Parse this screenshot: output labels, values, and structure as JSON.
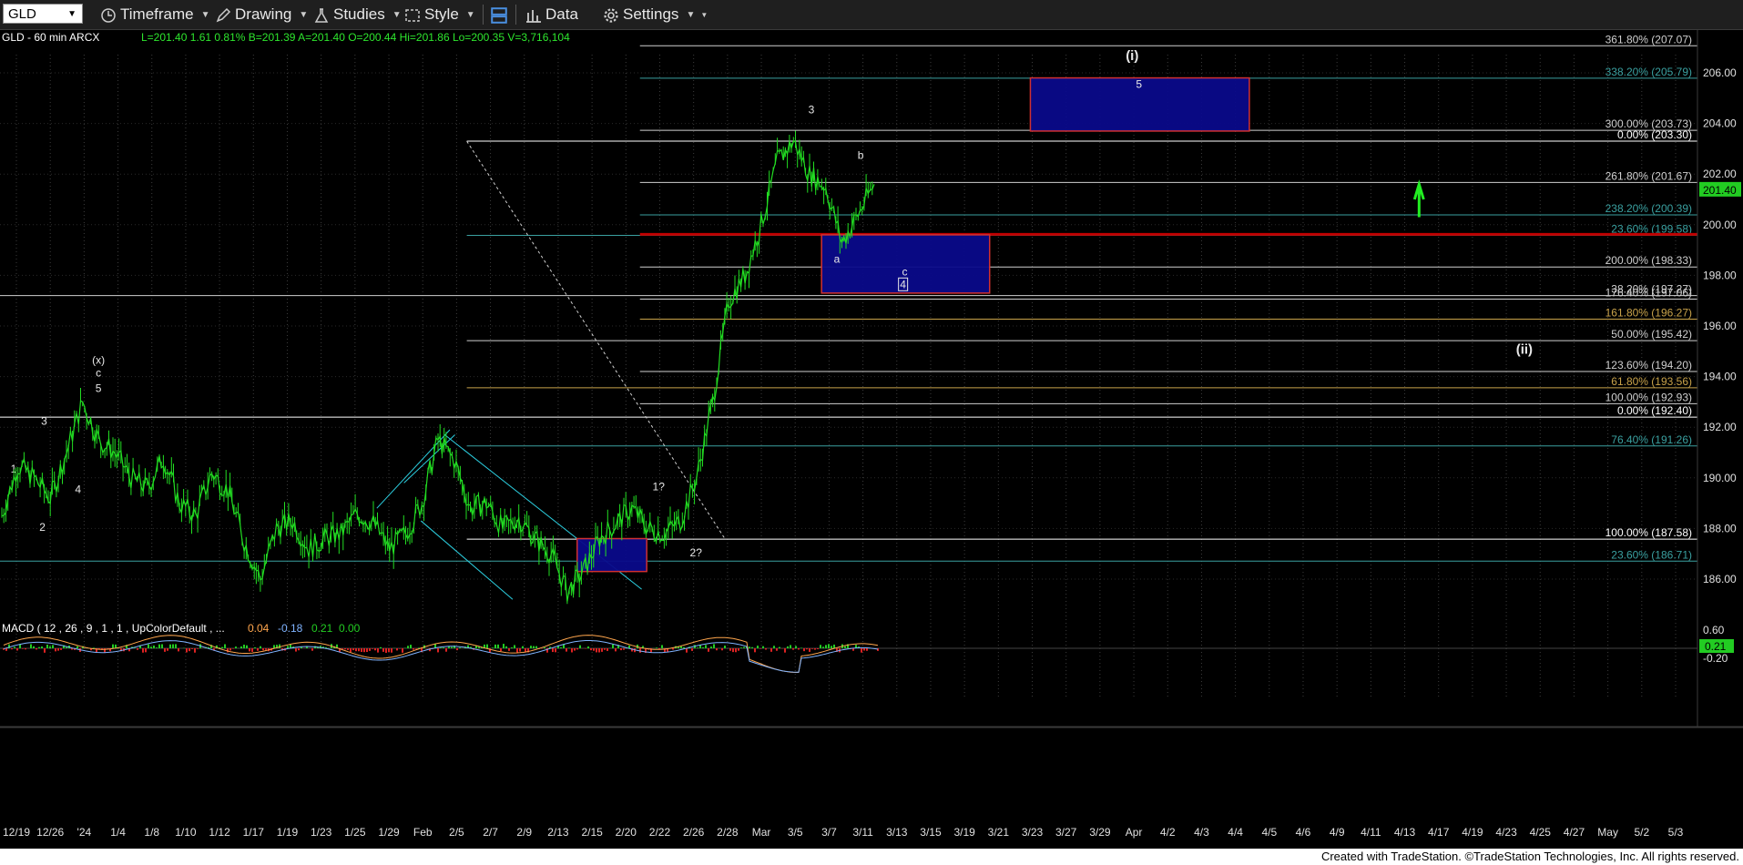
{
  "toolbar": {
    "symbol": "GLD",
    "timeframe": "Timeframe",
    "drawing": "Drawing",
    "studies": "Studies",
    "style": "Style",
    "data": "Data",
    "settings": "Settings"
  },
  "header": {
    "symbol_line": "GLD - 60 min  ARCX",
    "quote": "L=201.40  1.61  0.81%  B=201.39  A=201.40  O=200.44  Hi=201.86  Lo=200.35  V=3,716,104"
  },
  "macd": {
    "label": "MACD ( 12 , 26 , 9 , 1 , 1 , UpColorDefault , ...",
    "v1": "0.04",
    "v2": "-0.18",
    "v3": "0.21",
    "v4": "0.00",
    "colors": {
      "v1": "#ffa64d",
      "v2": "#7fb3ff",
      "v3": "#22cc22",
      "v4": "#22cc22"
    }
  },
  "footer": {
    "credit": "Created with TradeStation. ©TradeStation Technologies, Inc. All rights reserved."
  },
  "chart_data": {
    "type": "line",
    "title": "GLD - 60 min",
    "price_axis": {
      "ticks": [
        "206.00",
        "204.00",
        "202.00",
        "200.00",
        "198.00",
        "196.00",
        "194.00",
        "192.00",
        "190.00",
        "188.00",
        "186.00"
      ],
      "ylim": [
        185.3,
        207.3
      ]
    },
    "macd_axis": {
      "ticks": [
        "0.60",
        "-0.20"
      ],
      "current": "0.21"
    },
    "current_price": "201.40",
    "x_ticks": [
      "12/19",
      "12/26",
      "'24",
      "1/4",
      "1/8",
      "1/10",
      "1/12",
      "1/17",
      "1/19",
      "1/23",
      "1/25",
      "1/29",
      "Feb",
      "2/5",
      "2/7",
      "2/9",
      "2/13",
      "2/15",
      "2/20",
      "2/22",
      "2/26",
      "2/28",
      "Mar",
      "3/5",
      "3/7",
      "3/11",
      "3/13",
      "3/15",
      "3/19",
      "3/21",
      "3/23",
      "3/27",
      "3/29",
      "Apr",
      "4/2",
      "4/3",
      "4/4",
      "4/5",
      "4/6",
      "4/9",
      "4/11",
      "4/13",
      "4/17",
      "4/19",
      "4/23",
      "4/25",
      "4/27",
      "May",
      "5/2",
      "5/3"
    ],
    "price_path": [
      [
        0,
        188.5
      ],
      [
        1,
        190.5
      ],
      [
        2,
        190.0
      ],
      [
        3,
        189.2
      ],
      [
        4,
        191.0
      ],
      [
        5,
        193.0
      ],
      [
        6,
        191.5
      ],
      [
        7,
        191.0
      ],
      [
        8,
        190.0
      ],
      [
        9,
        189.6
      ],
      [
        10,
        190.8
      ],
      [
        11,
        189.0
      ],
      [
        12,
        188.5
      ],
      [
        13,
        190.2
      ],
      [
        14,
        189.5
      ],
      [
        15,
        187.5
      ],
      [
        16,
        186.0
      ],
      [
        17,
        188.0
      ],
      [
        18,
        188.3
      ],
      [
        19,
        187.2
      ],
      [
        20,
        187.6
      ],
      [
        21,
        187.8
      ],
      [
        22,
        188.6
      ],
      [
        23,
        188.2
      ],
      [
        24,
        187.2
      ],
      [
        25,
        187.8
      ],
      [
        26,
        189.0
      ],
      [
        27,
        191.5
      ],
      [
        28,
        190.7
      ],
      [
        29,
        188.8
      ],
      [
        30,
        189.0
      ],
      [
        31,
        188.0
      ],
      [
        32,
        188.4
      ],
      [
        33,
        187.6
      ],
      [
        34,
        187.0
      ],
      [
        35,
        185.5
      ],
      [
        36,
        186.3
      ],
      [
        37,
        187.6
      ],
      [
        38,
        188.2
      ],
      [
        39,
        188.8
      ],
      [
        40,
        188.0
      ],
      [
        41,
        187.8
      ],
      [
        42,
        188.3
      ],
      [
        43,
        190.0
      ],
      [
        44,
        193.0
      ],
      [
        45,
        197.0
      ],
      [
        46,
        198.0
      ],
      [
        47,
        200.0
      ],
      [
        48,
        202.5
      ],
      [
        49,
        203.3
      ],
      [
        50,
        202.0
      ],
      [
        51,
        201.5
      ],
      [
        52,
        199.3
      ],
      [
        53,
        200.4
      ],
      [
        54,
        201.6
      ]
    ],
    "annotations": {
      "h_lines": [
        {
          "price": 207.07,
          "label": "361.80% (207.07)",
          "x0": 0.377,
          "color": "#cfcfcf"
        },
        {
          "price": 205.79,
          "label": "338.20% (205.79)",
          "x0": 0.377,
          "color": "#3aa0a0"
        },
        {
          "price": 203.73,
          "label": "300.00% (203.73)",
          "x0": 0.377,
          "color": "#cfcfcf"
        },
        {
          "price": 203.3,
          "label": "0.00% (203.30)",
          "x0": 0.275,
          "color": "#ffffff"
        },
        {
          "price": 201.67,
          "label": "261.80% (201.67)",
          "x0": 0.377,
          "color": "#cfcfcf"
        },
        {
          "price": 200.39,
          "label": "238.20% (200.39)",
          "x0": 0.377,
          "color": "#3aa0a0"
        },
        {
          "price": 199.58,
          "label": "23.60% (199.58)",
          "x0": 0.275,
          "color": "#3aa0a0"
        },
        {
          "price": 198.33,
          "label": "200.00% (198.33)",
          "x0": 0.377,
          "color": "#cfcfcf"
        },
        {
          "price": 197.2,
          "label": "38.20% (197.27)",
          "x0": 0.0,
          "color": "#cfcfcf"
        },
        {
          "price": 197.06,
          "label": "176.40% (197.06)",
          "x0": 0.377,
          "color": "#cfcfcf"
        },
        {
          "price": 196.27,
          "label": "161.80% (196.27)",
          "x0": 0.377,
          "color": "#c8a24a"
        },
        {
          "price": 195.42,
          "label": "50.00% (195.42)",
          "x0": 0.275,
          "color": "#cfcfcf"
        },
        {
          "price": 194.2,
          "label": "123.60% (194.20)",
          "x0": 0.377,
          "color": "#cfcfcf"
        },
        {
          "price": 193.56,
          "label": "61.80% (193.56)",
          "x0": 0.275,
          "color": "#c8a24a"
        },
        {
          "price": 192.93,
          "label": "100.00% (192.93)",
          "x0": 0.377,
          "color": "#cfcfcf"
        },
        {
          "price": 192.4,
          "label": "0.00% (192.40)",
          "x0": 0.0,
          "color": "#ffffff"
        },
        {
          "price": 191.26,
          "label": "76.40% (191.26)",
          "x0": 0.275,
          "color": "#3aa0a0"
        },
        {
          "price": 187.58,
          "label": "100.00% (187.58)",
          "x0": 0.275,
          "color": "#ffffff"
        },
        {
          "price": 186.71,
          "label": "23.60% (186.71)",
          "x0": 0.0,
          "color": "#3aa0a0"
        }
      ],
      "red_line": 199.62,
      "boxes": [
        {
          "name": "target-box-i",
          "x0": 0.607,
          "x1": 0.736,
          "p0": 205.8,
          "p1": 203.7
        },
        {
          "name": "target-box-4",
          "x0": 0.484,
          "x1": 0.583,
          "p0": 199.6,
          "p1": 197.3
        },
        {
          "name": "support-box-2",
          "x0": 0.34,
          "x1": 0.381,
          "p0": 187.6,
          "p1": 186.3
        }
      ],
      "wave_labels": [
        {
          "t": "(i)",
          "x": 0.667,
          "p": 206.5,
          "size": 15
        },
        {
          "t": "5",
          "x": 0.671,
          "p": 205.4,
          "size": 12
        },
        {
          "t": "3",
          "x": 0.478,
          "p": 204.4,
          "size": 12
        },
        {
          "t": "b",
          "x": 0.507,
          "p": 202.6,
          "size": 12
        },
        {
          "t": "a",
          "x": 0.493,
          "p": 198.5,
          "size": 12
        },
        {
          "t": "c",
          "x": 0.533,
          "p": 198.0,
          "size": 12
        },
        {
          "t": "4",
          "x": 0.532,
          "p": 197.5,
          "size": 12
        },
        {
          "t": "(ii)",
          "x": 0.898,
          "p": 194.9,
          "size": 15
        },
        {
          "t": "(x)",
          "x": 0.058,
          "p": 194.5,
          "size": 12
        },
        {
          "t": "c",
          "x": 0.058,
          "p": 194.0,
          "size": 12
        },
        {
          "t": "5",
          "x": 0.058,
          "p": 193.4,
          "size": 12
        },
        {
          "t": "3",
          "x": 0.026,
          "p": 192.1,
          "size": 12
        },
        {
          "t": "1",
          "x": 0.008,
          "p": 190.2,
          "size": 12
        },
        {
          "t": "4",
          "x": 0.046,
          "p": 189.4,
          "size": 12
        },
        {
          "t": "2",
          "x": 0.025,
          "p": 187.9,
          "size": 12
        },
        {
          "t": "1?",
          "x": 0.388,
          "p": 189.5,
          "size": 12
        },
        {
          "t": "2?",
          "x": 0.41,
          "p": 186.9,
          "size": 12
        }
      ]
    }
  }
}
